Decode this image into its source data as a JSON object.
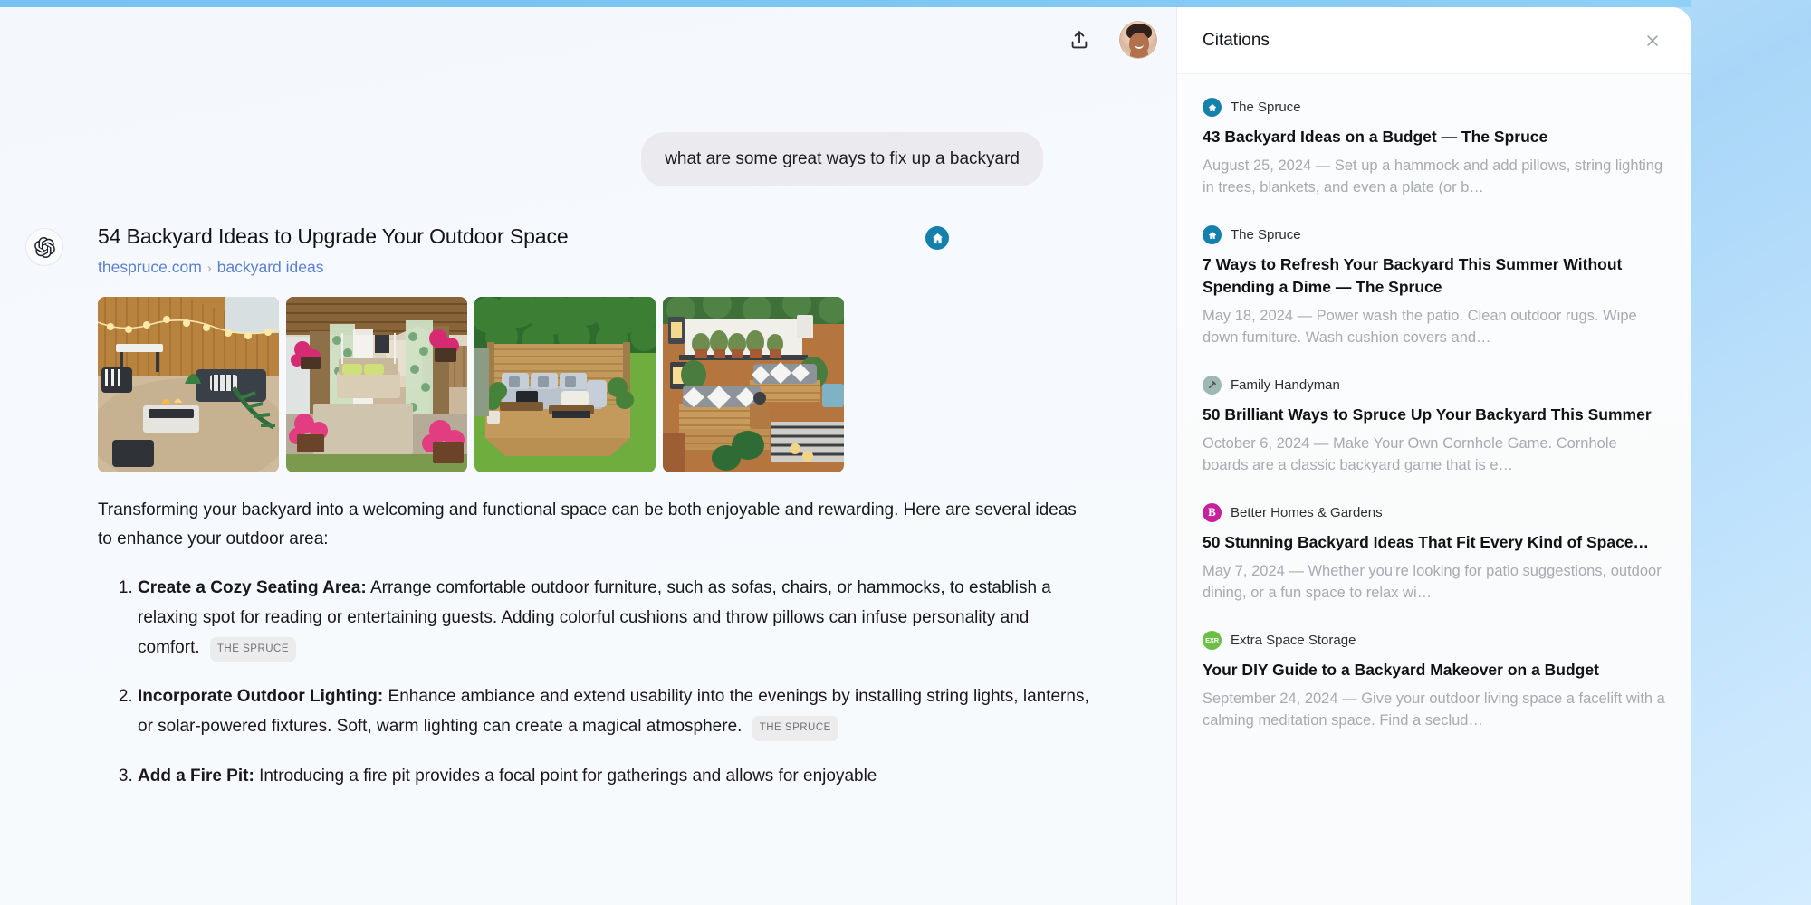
{
  "header": {
    "share_icon": "share-upload-icon",
    "avatar_label": "user-avatar"
  },
  "conversation": {
    "user_message": "what are some great ways to fix up a backyard",
    "assistant_icon": "openai-logo-icon"
  },
  "result_card": {
    "title": "54 Backyard Ideas to Upgrade Your Outdoor Space",
    "breadcrumb_domain": "thespruce.com",
    "breadcrumb_sep": "›",
    "breadcrumb_path": "backyard ideas",
    "badge_icon": "house-icon",
    "badge_color": "#1480ab",
    "thumbnails": [
      {
        "name": "backyard-firepit-string-lights-thumbnail"
      },
      {
        "name": "pergola-swing-curtains-thumbnail"
      },
      {
        "name": "corner-sofa-wooden-deck-thumbnail"
      },
      {
        "name": "pallet-seating-patio-thumbnail"
      }
    ]
  },
  "answer": {
    "intro": "Transforming your backyard into a welcoming and functional space can be both enjoyable and rewarding. Here are several ideas to enhance your outdoor area:",
    "items": [
      {
        "heading": "Create a Cozy Seating Area:",
        "text": "Arrange comfortable outdoor furniture, such as sofas, chairs, or hammocks, to establish a relaxing spot for reading or entertaining guests. Adding colorful cushions and throw pillows can infuse personality and comfort.",
        "citation": "THE SPRUCE"
      },
      {
        "heading": "Incorporate Outdoor Lighting:",
        "text": "Enhance ambiance and extend usability into the evenings by installing string lights, lanterns, or solar-powered fixtures. Soft, warm lighting can create a magical atmosphere.",
        "citation": "THE SPRUCE"
      },
      {
        "heading": "Add a Fire Pit:",
        "text": "Introducing a fire pit provides a focal point for gatherings and allows for enjoyable",
        "citation": ""
      }
    ]
  },
  "citations_panel": {
    "title": "Citations",
    "close_icon": "close-icon",
    "items": [
      {
        "source": "The Spruce",
        "icon": "house-icon",
        "icon_bg": "#1480ab",
        "icon_text": "",
        "title": "43 Backyard Ideas on a Budget — The Spruce",
        "snippet": "August 25, 2024 — Set up a hammock and add pillows, string lighting in trees, blankets, and even a plate (or b…"
      },
      {
        "source": "The Spruce",
        "icon": "house-icon",
        "icon_bg": "#1480ab",
        "icon_text": "",
        "title": "7 Ways to Refresh Your Backyard This Summer Without Spending a Dime — The Spruce",
        "snippet": "May 18, 2024 — Power wash the patio. Clean outdoor rugs. Wipe down furniture. Wash cushion covers and…"
      },
      {
        "source": "Family Handyman",
        "icon": "hammer-icon",
        "icon_bg": "#9fb8b4",
        "icon_text": "",
        "title": "50 Brilliant Ways to Spruce Up Your Backyard This Summer",
        "snippet": "October 6, 2024 — Make Your Own Cornhole Game. Cornhole boards are a classic backyard game that is e…"
      },
      {
        "source": "Better Homes & Gardens",
        "icon": "letter-b-icon",
        "icon_bg": "#c4219a",
        "icon_text": "B",
        "title": "50 Stunning Backyard Ideas That Fit Every Kind of Space…",
        "snippet": "May 7, 2024 — Whether you're looking for patio suggestions, outdoor dining, or a fun space to relax wi…"
      },
      {
        "source": "Extra Space Storage",
        "icon": "exr-logo-icon",
        "icon_bg": "#6cbe45",
        "icon_text": "EXR",
        "title": "Your DIY Guide to a Backyard Makeover on a Budget",
        "snippet": "September 24, 2024 — Give your outdoor living space a facelift with a calming meditation space. Find a seclud…"
      }
    ]
  }
}
